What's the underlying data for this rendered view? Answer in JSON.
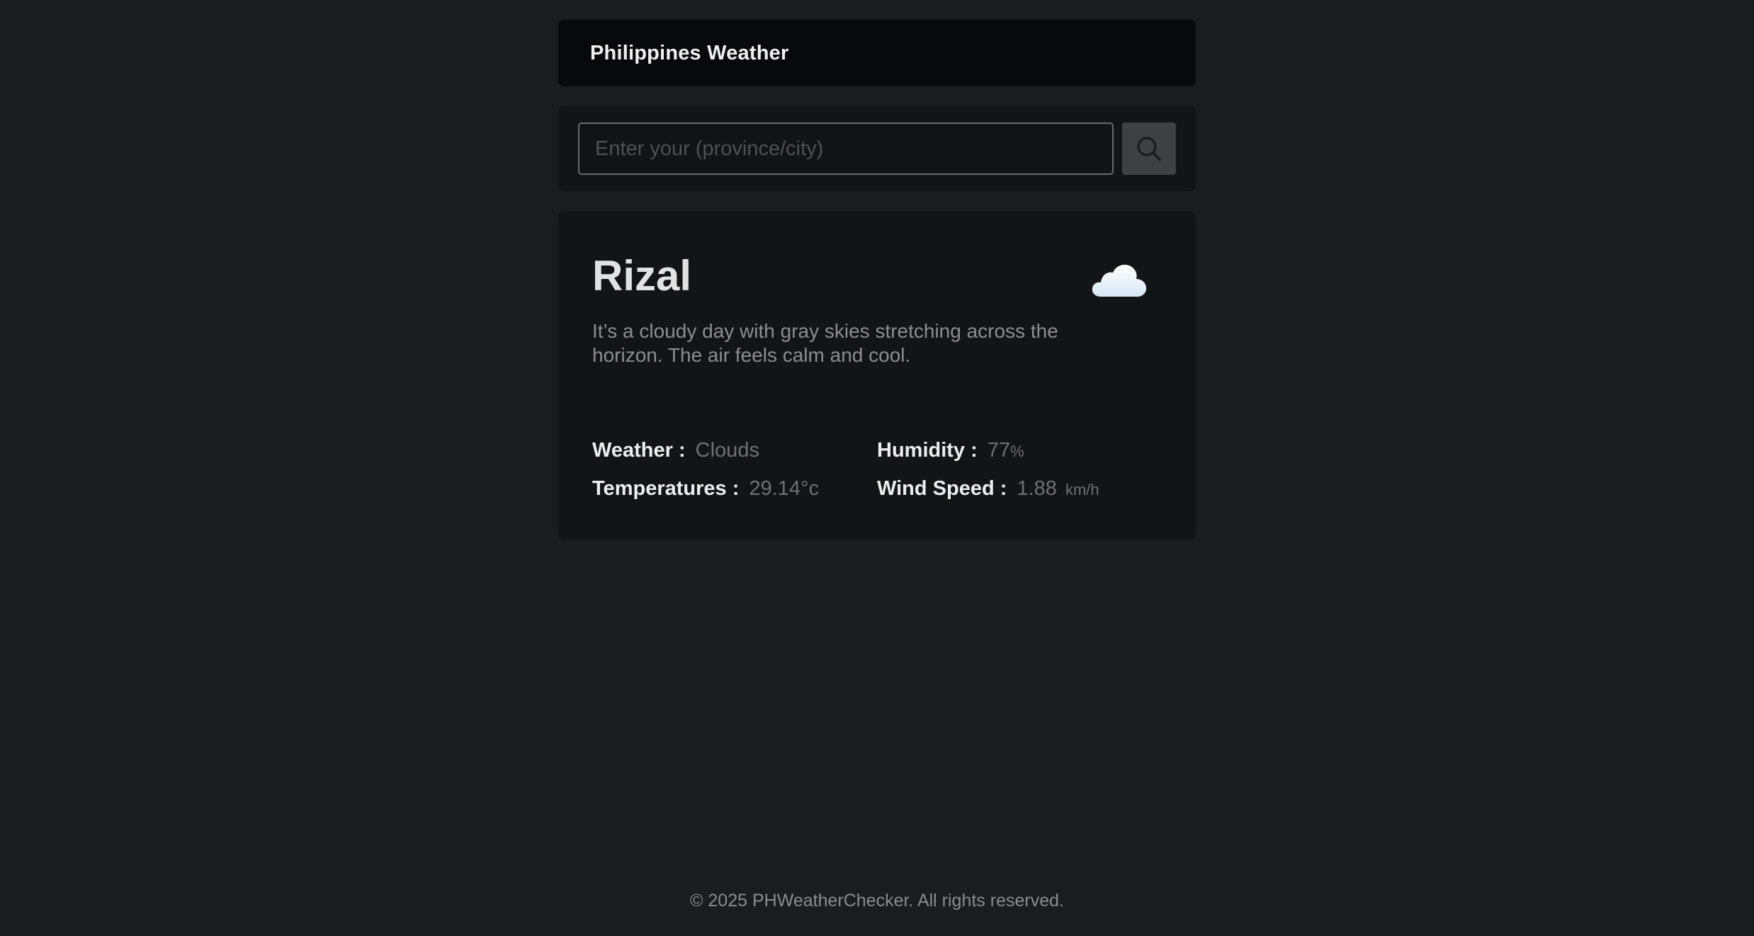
{
  "header": {
    "title": "Philippines Weather"
  },
  "search": {
    "placeholder": "Enter your (province/city)",
    "value": "",
    "button_icon": "search-icon"
  },
  "weather": {
    "city": "Rizal",
    "icon": "cloud-icon",
    "description": "It’s a cloudy day with gray skies stretching across the horizon. The air feels calm and cool.",
    "weather_label": "Weather :",
    "weather_value": "Clouds",
    "humidity_label": "Humidity :",
    "humidity_value": "77",
    "humidity_unit": "%",
    "temperature_label": "Temperatures :",
    "temperature_value": "29.14°c",
    "wind_label": "Wind Speed :",
    "wind_value": "1.88",
    "wind_unit": "km/h"
  },
  "footer": {
    "text": "© 2025 PHWeatherChecker. All rights reserved."
  },
  "colors": {
    "background": "#1b1c1e",
    "header_bg": "#08090b",
    "panel_bg": "#131416",
    "button_bg": "#3f4042",
    "muted_text": "#6f7073"
  }
}
